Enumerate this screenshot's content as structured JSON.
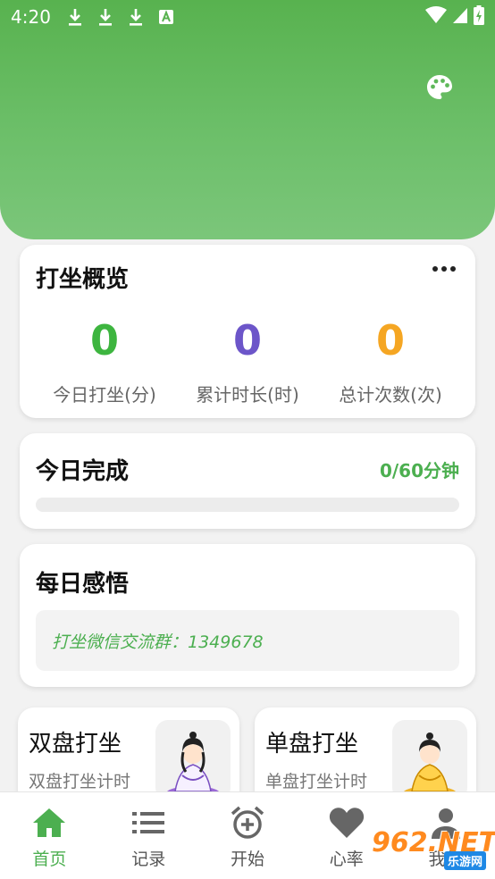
{
  "status_bar": {
    "time": "4:20",
    "notification_icons": [
      "download-icon",
      "download-icon",
      "download-icon",
      "font-a-icon"
    ],
    "right_icons": [
      "wifi-icon",
      "signal-icon",
      "battery-charging-icon"
    ]
  },
  "header": {
    "theme_icon": "palette-icon",
    "gradient_colors": [
      "#58b24f",
      "#7bc67a"
    ]
  },
  "overview": {
    "title": "打坐概览",
    "more_icon": "more-horizontal-icon",
    "stats": [
      {
        "value": "0",
        "label": "今日打坐(分)",
        "color": "#3db53f"
      },
      {
        "value": "0",
        "label": "累计时长(时)",
        "color": "#6c55c9"
      },
      {
        "value": "0",
        "label": "总计次数(次)",
        "color": "#f5a623"
      }
    ]
  },
  "today": {
    "title": "今日完成",
    "progress_text": "0/60分钟",
    "progress_fraction": 0.0
  },
  "insight": {
    "title": "每日感悟",
    "text": "打坐微信交流群：1349678"
  },
  "modes": [
    {
      "title": "双盘打坐",
      "subtitle": "双盘打坐计时",
      "image": "meditating-figure-purple"
    },
    {
      "title": "单盘打坐",
      "subtitle": "单盘打坐计时",
      "image": "meditating-figure-yellow"
    }
  ],
  "bottom_nav": [
    {
      "label": "首页",
      "icon": "home-icon",
      "active": true
    },
    {
      "label": "记录",
      "icon": "list-icon",
      "active": false
    },
    {
      "label": "开始",
      "icon": "alarm-add-icon",
      "active": false
    },
    {
      "label": "心率",
      "icon": "heart-icon",
      "active": false
    },
    {
      "label": "我的",
      "icon": "person-icon",
      "active": false
    }
  ],
  "watermark": {
    "main": "962.NET",
    "sub": "乐游网"
  },
  "colors": {
    "accent": "#4caf50",
    "background": "#f2f2f2"
  }
}
